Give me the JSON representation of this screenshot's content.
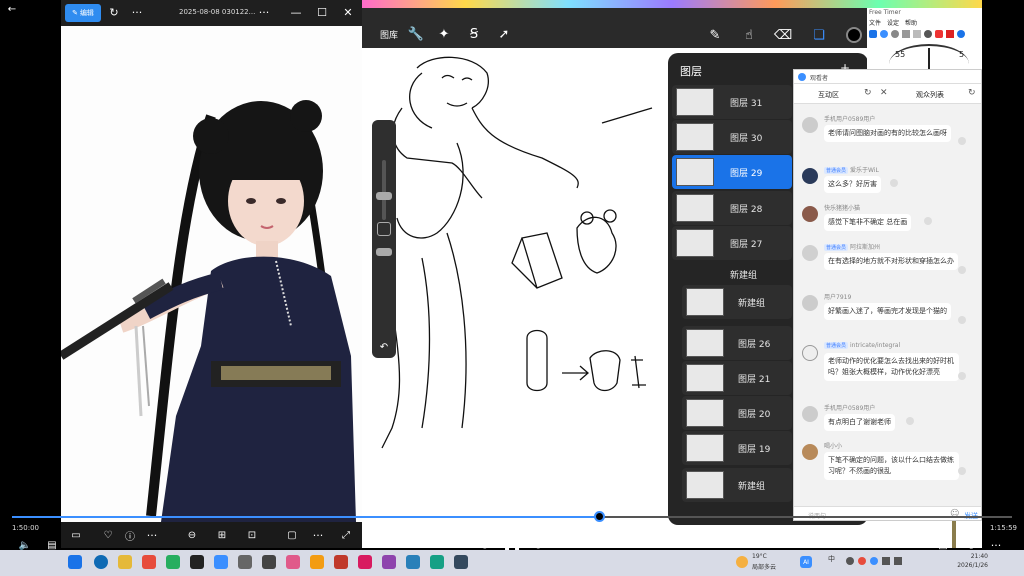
{
  "topbar": {
    "back_icon": "arrow-left-icon"
  },
  "photo_viewer": {
    "edit_label": "编辑",
    "filename": "2025-08-08 030122...",
    "more_label": "···",
    "more2_label": "···"
  },
  "procreate": {
    "gallery_label": "图库",
    "window_controls": {
      "expand": "⤢",
      "minimize": "—",
      "maximize": "☐",
      "close": "✕"
    }
  },
  "layers": {
    "title": "图层",
    "add": "+",
    "items": [
      {
        "label": "图层 31",
        "selected": false
      },
      {
        "label": "图层 30",
        "selected": false
      },
      {
        "label": "图层 29",
        "selected": true
      },
      {
        "label": "图层 28",
        "selected": false
      },
      {
        "label": "图层 27",
        "selected": false
      }
    ],
    "new_group_header": "新建组",
    "group_items": [
      {
        "label": "新建组"
      },
      {
        "label": "图层 26"
      },
      {
        "label": "图层 21"
      },
      {
        "label": "图层 20"
      },
      {
        "label": "图层 19"
      },
      {
        "label": "新建组"
      }
    ]
  },
  "timer": {
    "title": "Free Timer",
    "menu": [
      "文件",
      "设定",
      "帮助"
    ],
    "dial_left": "55",
    "dial_right": "5"
  },
  "chat": {
    "window_title": "观看者",
    "tab_left": "互动区",
    "tab_right": "观众列表",
    "messages": [
      {
        "user": "手机用户0589用户",
        "text": "老师请问图脑对画的有的比较怎么画呀",
        "badge": ""
      },
      {
        "user": "爱乐于WiL",
        "text": "这么多？好厉害",
        "badge": "普通会员"
      },
      {
        "user": "快乐猪猪小猫",
        "text": "感觉下笔非不确定 总在画",
        "badge": ""
      },
      {
        "user": "阿拉斯加州",
        "text": "在有选择的地方就不对形状和穿插怎么办",
        "badge": "普通会员"
      },
      {
        "user": "用户7919",
        "text": "好繁画入迷了，等画完才发现是个猫的",
        "badge": ""
      },
      {
        "user": "intricate/integral",
        "text": "老师动作的优化要怎么去找出来的好时机吗？姐张大概模样，动作优化好漂亮",
        "badge": "普通会员"
      },
      {
        "user": "手机用户0589用户",
        "text": "有点明白了谢谢老师",
        "badge": ""
      },
      {
        "user": "喝小小",
        "text": "下笔不确定的问题，该以什么口结去做练习呢？不然画的很乱",
        "badge": ""
      }
    ],
    "input_placeholder": "说两句…",
    "send_label": "发送"
  },
  "player": {
    "time_current": "1:50:00",
    "time_total": "1:15:59",
    "progress": 0.587,
    "skip_back": "10",
    "skip_fwd": "30"
  },
  "taskbar": {
    "weather_temp": "19°C",
    "weather_desc": "局部多云",
    "clock_time": "21:40",
    "clock_date": "2026/1/26",
    "ime": "中"
  }
}
